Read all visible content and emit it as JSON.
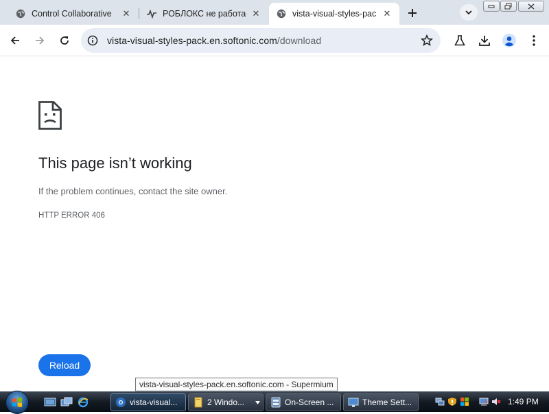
{
  "browser": {
    "tabs": [
      {
        "title": "Control Collaborative",
        "favicon": "globe-icon"
      },
      {
        "title": "РОБЛОКС не работае",
        "favicon": "pulse-icon"
      },
      {
        "title": "vista-visual-styles-pac",
        "favicon": "globe-icon",
        "active": true
      }
    ],
    "address_bar": {
      "url_host": "vista-visual-styles-pack.en.softonic.com",
      "url_path": "/download"
    }
  },
  "error_page": {
    "title": "This page isn’t working",
    "description": "If the problem continues, contact the site owner.",
    "code": "HTTP ERROR 406",
    "reload_label": "Reload"
  },
  "tooltip": "vista-visual-styles-pack.en.softonic.com - Supermium",
  "taskbar": {
    "buttons": [
      {
        "label": "vista-visual...",
        "icon": "browser-icon",
        "active": true
      },
      {
        "label": "2 Windo...",
        "icon": "folder-icon",
        "has_dropdown": true
      },
      {
        "label": "On-Screen ...",
        "icon": "keyboard-icon"
      },
      {
        "label": "Theme Sett...",
        "icon": "monitor-icon"
      }
    ],
    "clock": "1:49 PM"
  },
  "colors": {
    "accent": "#1a73e8",
    "tabstrip": "#dde3ea",
    "omnibox": "#e9eef6"
  }
}
